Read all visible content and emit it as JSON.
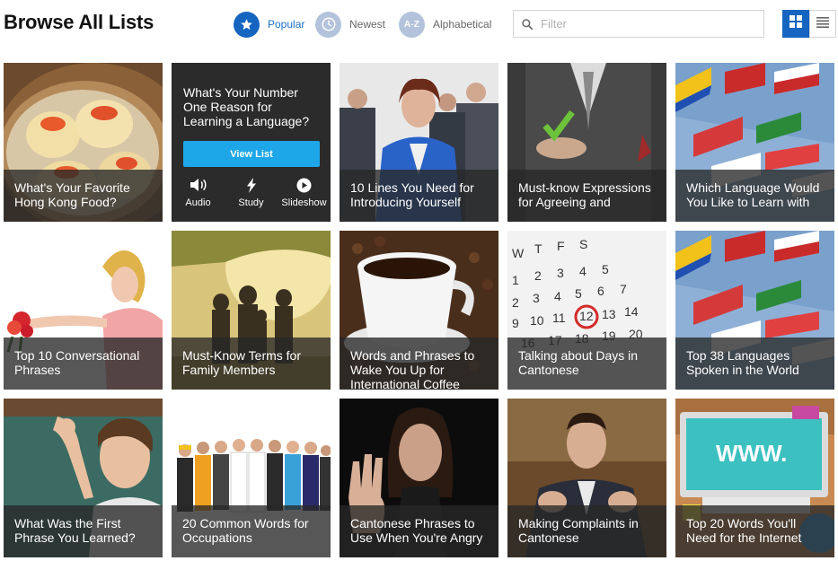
{
  "header": {
    "title": "Browse All Lists",
    "sort": {
      "popular": "Popular",
      "newest": "Newest",
      "alphabetical": "Alphabetical",
      "alpha_badge": "A-Z",
      "active": "popular"
    },
    "filter_placeholder": "Filter",
    "view_active": "grid"
  },
  "colors": {
    "accent": "#1565c0",
    "view_button": "#1ea7e8",
    "inactive_sort": "#b4c3dc"
  },
  "hover_card": {
    "question": "What's Your Number One Reason for Learning a Language?",
    "button": "View List",
    "actions": [
      {
        "label": "Audio",
        "icon": "speaker-icon"
      },
      {
        "label": "Study",
        "icon": "lightning-icon"
      },
      {
        "label": "Slideshow",
        "icon": "play-icon"
      }
    ]
  },
  "cards": [
    {
      "title": "What's Your Favorite Hong Kong Food?",
      "image": "dumplings"
    },
    {
      "title": "What's Your Number One Reason for Learning a Language?",
      "image": "hover"
    },
    {
      "title": "10 Lines You Need for Introducing Yourself",
      "image": "business-people"
    },
    {
      "title": "Must-know Expressions for Agreeing and",
      "image": "checkmark-hand"
    },
    {
      "title": "Which Language Would You Like to Learn with",
      "image": "flags"
    },
    {
      "title": "Top 10 Conversational Phrases",
      "image": "woman-flowers"
    },
    {
      "title": "Must-Know Terms for Family Members",
      "image": "family-park"
    },
    {
      "title": "Words and Phrases to Wake You Up for International Coffee",
      "image": "coffee"
    },
    {
      "title": "Talking about Days in Cantonese",
      "image": "calendar"
    },
    {
      "title": "Top 38 Languages Spoken in the World",
      "image": "flags"
    },
    {
      "title": "What Was the First Phrase You Learned?",
      "image": "man-chalkboard"
    },
    {
      "title": "20 Common Words for Occupations",
      "image": "occupations"
    },
    {
      "title": "Cantonese Phrases to Use When You're Angry",
      "image": "angry-woman"
    },
    {
      "title": "Making Complaints in Cantonese",
      "image": "complaint-man"
    },
    {
      "title": "Top 20 Words You'll Need for the Internet",
      "image": "www-laptop"
    }
  ]
}
